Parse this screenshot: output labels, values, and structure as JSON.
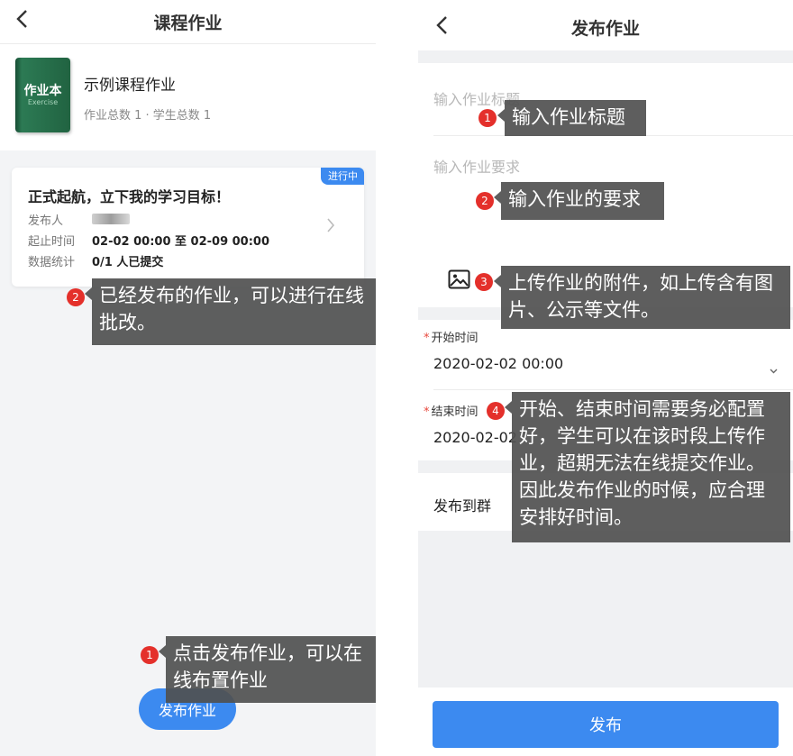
{
  "left": {
    "title": "课程作业",
    "course": {
      "book_title": "作业本",
      "book_subtitle": "Exercise",
      "name": "示例课程作业",
      "stats": "作业总数 1 · 学生总数 1"
    },
    "card": {
      "badge": "进行中",
      "title": "正式起航，立下我的学习目标！",
      "rows": [
        {
          "label": "发布人",
          "value": ""
        },
        {
          "label": "起止时间",
          "value": "02-02 00:00 至 02-09 00:00"
        },
        {
          "label": "数据统计",
          "value": "0/1 人已提交"
        }
      ]
    },
    "publish_button": "发布作业",
    "annotations": [
      {
        "num": "2",
        "text": "已经发布的作业，可以进行在线批改。"
      },
      {
        "num": "1",
        "text": "点击发布作业，可以在线布置作业"
      }
    ]
  },
  "right": {
    "title": "发布作业",
    "title_placeholder": "输入作业标题",
    "requirement_placeholder": "输入作业要求",
    "start_label": "开始时间",
    "start_value": "2020-02-02 00:00",
    "end_label": "结束时间",
    "end_value": "2020-02-02",
    "publish_to_group": "发布到群",
    "submit_button": "发布",
    "annotations": [
      {
        "num": "1",
        "text": "输入作业标题"
      },
      {
        "num": "2",
        "text": "输入作业的要求"
      },
      {
        "num": "3",
        "text": "上传作业的附件，如上传含有图片、公示等文件。"
      },
      {
        "num": "4",
        "text": "开始、结束时间需要务必配置好，学生可以在该时段上传作业，超期无法在线提交作业。因此发布作业的时候，应合理安排好时间。"
      }
    ]
  },
  "colors": {
    "accent": "#3c8af0",
    "annotation_bg": "#505050",
    "pin": "#e4302b",
    "book_green": "#216341"
  },
  "icons": [
    "back-arrow-icon",
    "chevron-right-icon",
    "image-icon",
    "chevron-down-icon"
  ]
}
